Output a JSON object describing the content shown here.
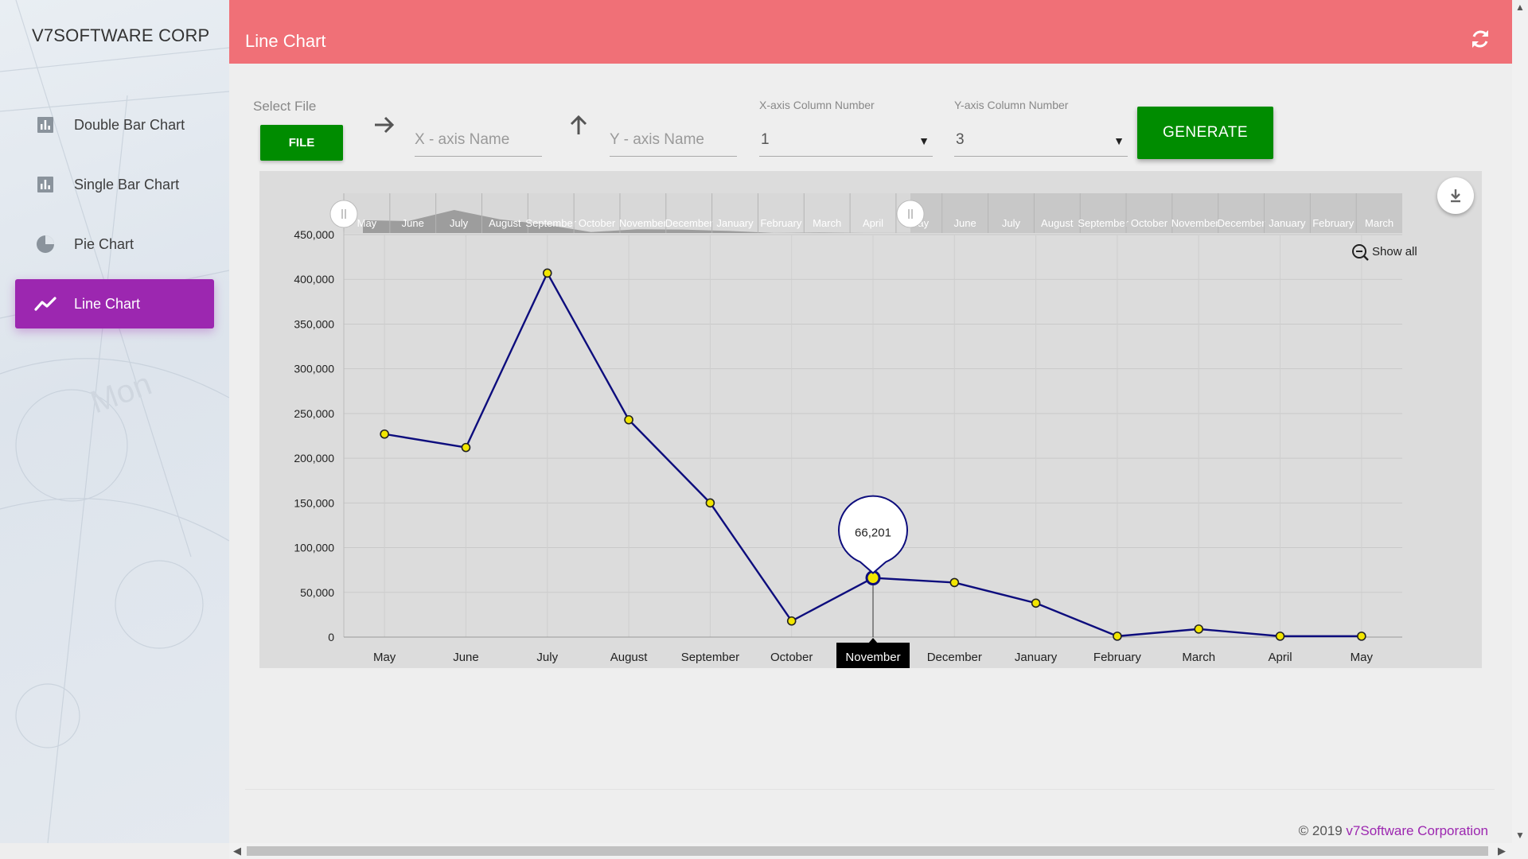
{
  "sidebar": {
    "brand": "V7SOFTWARE CORP",
    "items": [
      {
        "label": "Double Bar Chart",
        "icon": "bar-chart-icon"
      },
      {
        "label": "Single Bar Chart",
        "icon": "bar-chart-icon"
      },
      {
        "label": "Pie Chart",
        "icon": "pie-chart-icon"
      },
      {
        "label": "Line Chart",
        "icon": "line-chart-icon",
        "active": true
      }
    ]
  },
  "header": {
    "title": "Line Chart",
    "refresh_icon": "refresh-icon"
  },
  "form": {
    "select_file_label": "Select File",
    "file_button": "FILE",
    "x_axis_placeholder": "X - axis Name",
    "y_axis_placeholder": "Y - axis Name",
    "x_col_label": "X-axis Column Number",
    "x_col_value": "1",
    "y_col_label": "Y-axis Column Number",
    "y_col_value": "3",
    "generate_button": "GENERATE"
  },
  "chart_controls": {
    "show_all": "Show all",
    "download_icon": "download-icon",
    "zoom_out_icon": "zoom-out-icon"
  },
  "chart_data": {
    "type": "line",
    "categories": [
      "May",
      "June",
      "July",
      "August",
      "September",
      "October",
      "November",
      "December",
      "January",
      "February",
      "March",
      "April",
      "May"
    ],
    "values": [
      227000,
      212000,
      407000,
      243000,
      150000,
      18000,
      66201,
      61000,
      38000,
      1000,
      9000,
      1000,
      1000
    ],
    "ylim": [
      0,
      450000
    ],
    "yticks": [
      "0",
      "50,000",
      "100,000",
      "150,000",
      "200,000",
      "250,000",
      "300,000",
      "350,000",
      "400,000",
      "450,000"
    ],
    "scrollbar_labels": [
      "May",
      "June",
      "July",
      "August",
      "September",
      "October",
      "November",
      "December",
      "January",
      "February",
      "March",
      "April",
      "May",
      "June",
      "July",
      "August",
      "September",
      "October",
      "November",
      "December",
      "January",
      "February",
      "March"
    ],
    "tooltip": {
      "category": "November",
      "value": "66,201"
    },
    "line_color": "#0d0d7d",
    "point_color": "#f2e600"
  },
  "footer": {
    "copyright": "© 2019 ",
    "company": "v7Software Corporation"
  }
}
